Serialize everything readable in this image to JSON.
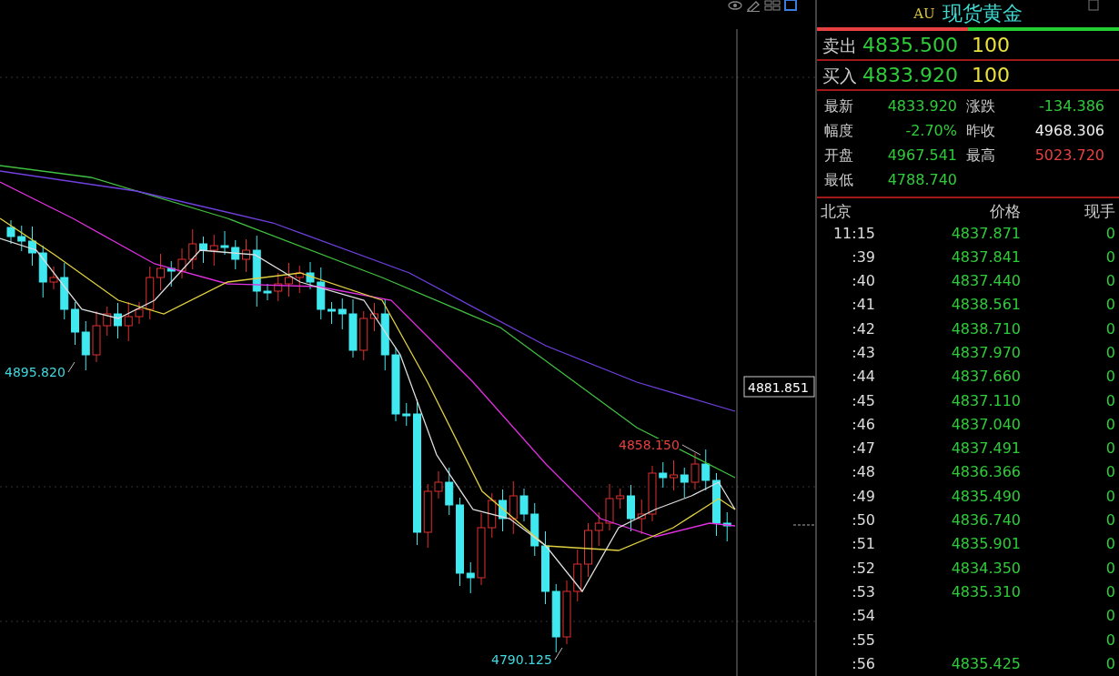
{
  "chart": {
    "price_tag": "4881.851",
    "annotations": [
      {
        "text": "4895.820",
        "kind": "low"
      },
      {
        "text": "4790.125",
        "kind": "low"
      },
      {
        "text": "4858.150",
        "kind": "high"
      }
    ]
  },
  "quote": {
    "prefix": "AU",
    "title": "现货黄金",
    "ratio_bar": {
      "level": 0.5
    },
    "ask": {
      "label": "卖出",
      "price": "4835.500",
      "volume": "100"
    },
    "bid": {
      "label": "买入",
      "price": "4833.920",
      "volume": "100"
    },
    "stats": [
      {
        "label": "最新",
        "value": "4833.920",
        "color": "#2fcc3a"
      },
      {
        "label": "涨跌",
        "value": "-134.386",
        "color": "#2fcc3a"
      },
      {
        "label": "幅度",
        "value": "-2.70%",
        "color": "#2fcc3a"
      },
      {
        "label": "昨收",
        "value": "4968.306",
        "color": "#eeeeee"
      },
      {
        "label": "开盘",
        "value": "4967.541",
        "color": "#2fcc3a"
      },
      {
        "label": "最高",
        "value": "5023.720",
        "color": "#e84040"
      },
      {
        "label": "最低",
        "value": "4788.740",
        "color": "#2fcc3a"
      }
    ]
  },
  "ticks": {
    "columns": [
      "北京",
      "价格",
      "现手"
    ],
    "rows": [
      {
        "time": "11:15",
        "price": "4837.871",
        "volume": "0"
      },
      {
        "time": ":39",
        "price": "4837.841",
        "volume": "0"
      },
      {
        "time": ":40",
        "price": "4837.440",
        "volume": "0"
      },
      {
        "time": ":41",
        "price": "4838.561",
        "volume": "0"
      },
      {
        "time": ":42",
        "price": "4838.710",
        "volume": "0"
      },
      {
        "time": ":43",
        "price": "4837.970",
        "volume": "0"
      },
      {
        "time": ":44",
        "price": "4837.660",
        "volume": "0"
      },
      {
        "time": ":45",
        "price": "4837.110",
        "volume": "0"
      },
      {
        "time": ":46",
        "price": "4837.040",
        "volume": "0"
      },
      {
        "time": ":47",
        "price": "4837.491",
        "volume": "0"
      },
      {
        "time": ":48",
        "price": "4836.366",
        "volume": "0"
      },
      {
        "time": ":49",
        "price": "4835.490",
        "volume": "0"
      },
      {
        "time": ":50",
        "price": "4836.740",
        "volume": "0"
      },
      {
        "time": ":51",
        "price": "4835.901",
        "volume": "0"
      },
      {
        "time": ":52",
        "price": "4834.350",
        "volume": "0"
      },
      {
        "time": ":53",
        "price": "4835.310",
        "volume": "0"
      },
      {
        "time": ":54",
        "volume": "0"
      },
      {
        "time": ":55",
        "volume": "0"
      },
      {
        "time": ":56",
        "price": "4835.425",
        "volume": "0"
      }
    ]
  }
}
